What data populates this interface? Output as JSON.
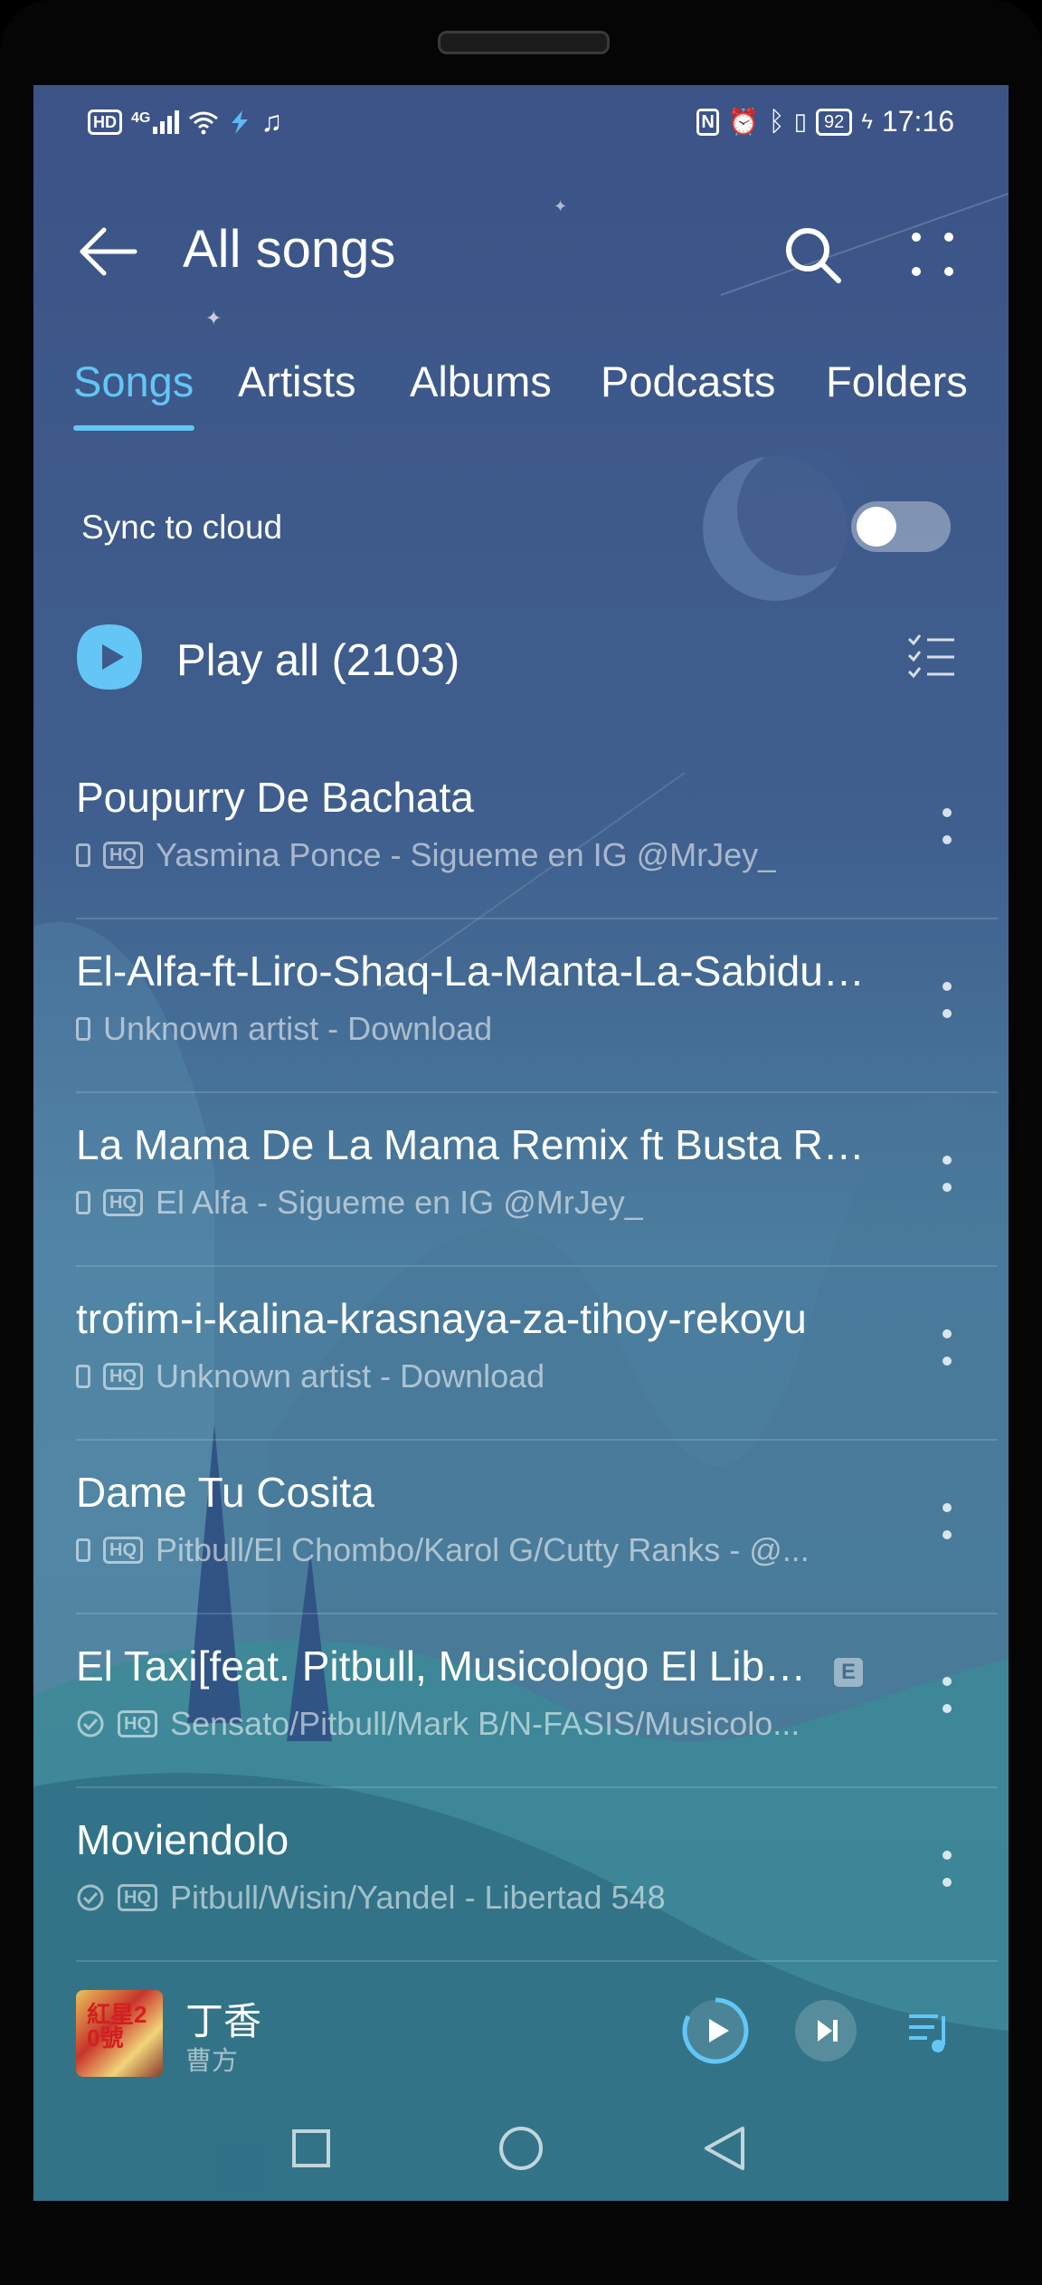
{
  "status_bar": {
    "left_icons": [
      "hd-icon",
      "4g-signal-icon",
      "wifi-icon",
      "app-notification-icon",
      "music-note-icon"
    ],
    "hd_label": "HD",
    "net_label": "4G",
    "right_icons": [
      "nfc-icon",
      "alarm-icon",
      "bluetooth-icon",
      "vibrate-icon"
    ],
    "battery": "92",
    "time": "17:16"
  },
  "header": {
    "title": "All songs"
  },
  "tabs": [
    {
      "label": "Songs",
      "active": true
    },
    {
      "label": "Artists",
      "active": false
    },
    {
      "label": "Albums",
      "active": false
    },
    {
      "label": "Podcasts",
      "active": false
    },
    {
      "label": "Folders",
      "active": false
    }
  ],
  "sync": {
    "label": "Sync to cloud",
    "enabled": false
  },
  "play_all": {
    "label": "Play all (2103)"
  },
  "songs": [
    {
      "title": "Poupurry De Bachata",
      "subtitle": "Yasmina Ponce - Sigueme en IG @MrJey_",
      "source": "phone",
      "hq": true,
      "explicit": false
    },
    {
      "title": "El-Alfa-ft-Liro-Shaq-La-Manta-La-Sabiduria-...",
      "subtitle": "Unknown artist - Download",
      "source": "phone",
      "hq": false,
      "explicit": false
    },
    {
      "title": "La Mama De La Mama Remix ft Busta Rhy...",
      "subtitle": "El Alfa - Sigueme en IG @MrJey_",
      "source": "phone",
      "hq": true,
      "explicit": false
    },
    {
      "title": "trofim-i-kalina-krasnaya-za-tihoy-rekoyu",
      "subtitle": "Unknown artist - Download",
      "source": "phone",
      "hq": true,
      "explicit": false
    },
    {
      "title": "Dame Tu Cosita",
      "subtitle": "Pitbull/El Chombo/Karol G/Cutty Ranks - @...",
      "source": "phone",
      "hq": true,
      "explicit": false
    },
    {
      "title": "El Taxi[feat. Pitbull, Musicologo El Libro...",
      "subtitle": "Sensato/Pitbull/Mark B/N-FASIS/Musicolo...",
      "source": "cloud",
      "hq": true,
      "explicit": true
    },
    {
      "title": "Moviendolo",
      "subtitle": "Pitbull/Wisin/Yandel - Libertad 548",
      "source": "cloud",
      "hq": true,
      "explicit": false
    }
  ],
  "badges": {
    "hq": "HQ",
    "explicit": "E"
  },
  "now_playing": {
    "title": "丁香",
    "artist": "曹方",
    "cover_text": "紅星20號",
    "state": "paused"
  },
  "colors": {
    "accent": "#63c6f4",
    "background_top": "#3c5387",
    "background_bottom": "#4b7d9e"
  }
}
